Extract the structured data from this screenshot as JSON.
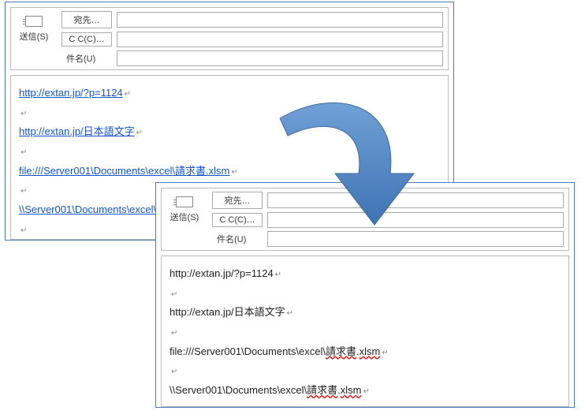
{
  "compose1": {
    "send_label": "送信(S)",
    "to_label": "宛先…",
    "cc_label": "C C(C)…",
    "subject_label": "件名(U)",
    "body_lines": [
      "http://extan.jp/?p=1124",
      "http://extan.jp/日本語文字",
      "file:///Server001\\Documents\\excel\\請求書.xlsm",
      "\\\\Server001\\Documents\\excel\\請求書.xlsm"
    ]
  },
  "compose2": {
    "send_label": "送信(S)",
    "to_label": "宛先…",
    "cc_label": "C C(C)…",
    "subject_label": "件名(U)",
    "body_lines": [
      "http://extan.jp/?p=1124",
      "http://extan.jp/日本語文字",
      "file:///Server001\\Documents\\excel\\請求書.xlsm",
      "\\\\Server001\\Documents\\excel\\請求書.xlsm"
    ]
  },
  "marks": {
    "paragraph": "↵"
  },
  "icons": {
    "send": "send-envelope-icon"
  },
  "colors": {
    "frame": "#4a7ebb",
    "link": "#1155cc",
    "arrow": "#4f81bd"
  }
}
